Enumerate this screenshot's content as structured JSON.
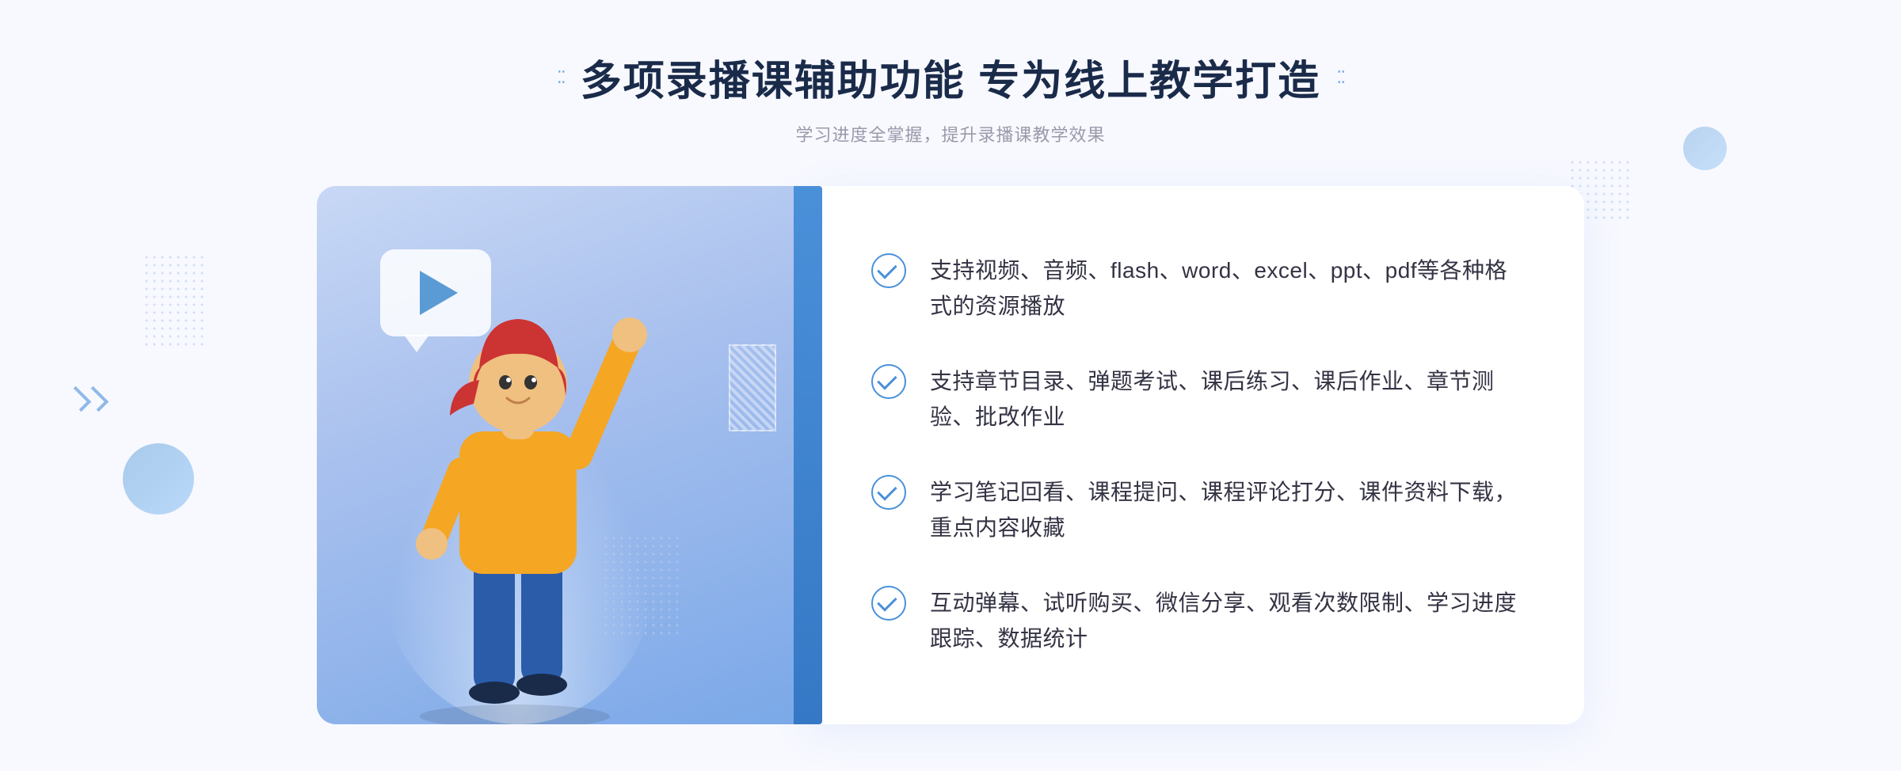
{
  "page": {
    "background_color": "#f5f7fd"
  },
  "header": {
    "title": "多项录播课辅助功能 专为线上教学打造",
    "subtitle": "学习进度全掌握，提升录播课教学效果",
    "dots_left": "⁚",
    "dots_right": "⁚"
  },
  "features": [
    {
      "id": 1,
      "text": "支持视频、音频、flash、word、excel、ppt、pdf等各种格式的资源播放"
    },
    {
      "id": 2,
      "text": "支持章节目录、弹题考试、课后练习、课后作业、章节测验、批改作业"
    },
    {
      "id": 3,
      "text": "学习笔记回看、课程提问、课程评论打分、课件资料下载，重点内容收藏"
    },
    {
      "id": 4,
      "text": "互动弹幕、试听购买、微信分享、观看次数限制、学习进度跟踪、数据统计"
    }
  ]
}
